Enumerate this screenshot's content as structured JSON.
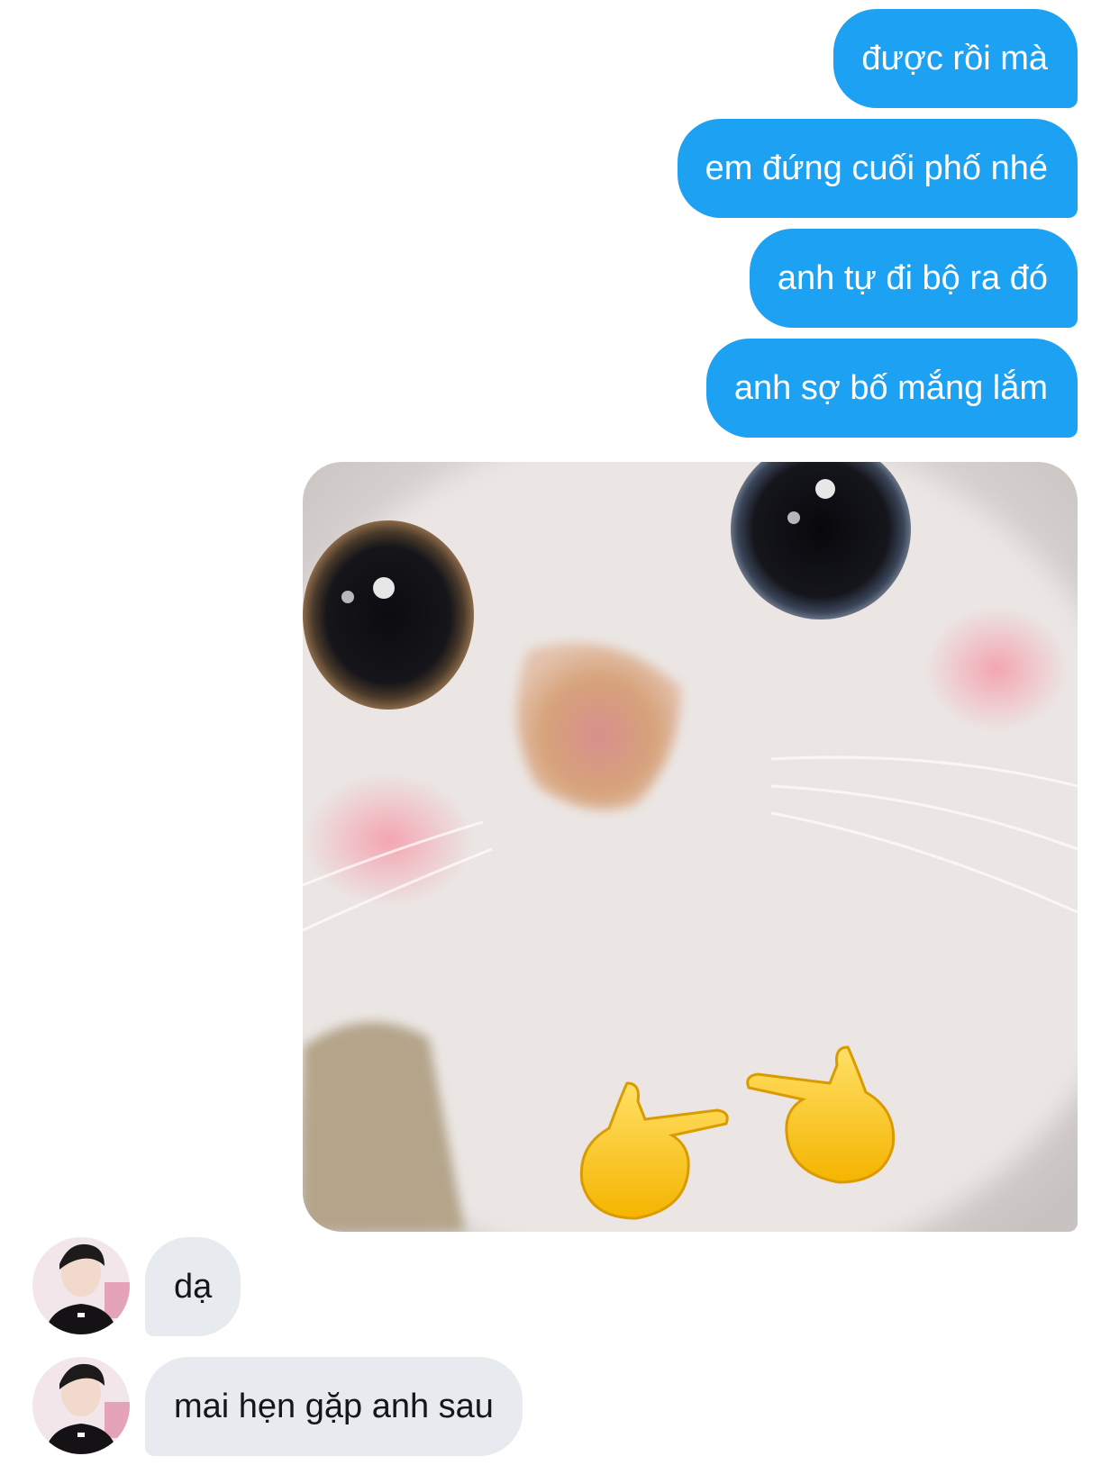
{
  "conversation": {
    "outgoing": [
      {
        "text": "được rồi mà"
      },
      {
        "text": "em đứng cuối phố nhé"
      },
      {
        "text": "anh tự đi bộ ra đó"
      },
      {
        "text": "anh sợ bố mắng lắm"
      }
    ],
    "media": {
      "description": "cat-meme-image",
      "emoji": "👉👉"
    },
    "incoming": [
      {
        "text": "dạ",
        "avatar": "contact-avatar"
      },
      {
        "text": "mai hẹn gặp anh sau",
        "avatar": "contact-avatar"
      }
    ]
  },
  "colors": {
    "outgoing_bubble": "#1da1f2",
    "incoming_bubble": "#e7eaee",
    "background": "#ffffff"
  }
}
